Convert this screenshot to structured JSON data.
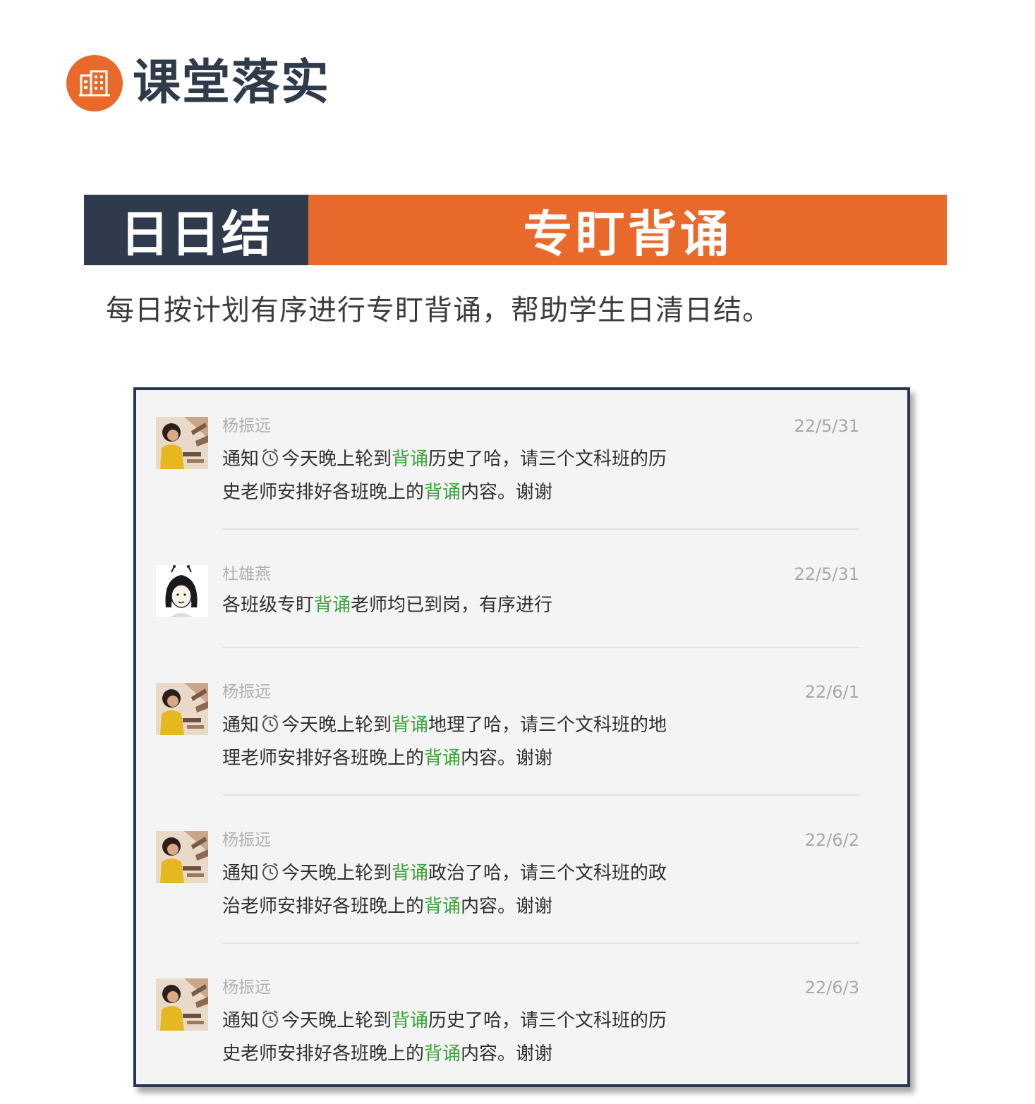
{
  "section": {
    "icon": "building-icon",
    "title": "课堂落实"
  },
  "banner": {
    "left_label": "日日结",
    "right_label": "专盯背诵"
  },
  "description": "每日按计划有序进行专盯背诵，帮助学生日清日结。",
  "colors": {
    "accent_orange": "#e8692a",
    "navy": "#2f3a4c",
    "highlight_green": "#3aa53a"
  },
  "chat": {
    "messages": [
      {
        "sender": "杨振远",
        "date": "22/5/31",
        "avatar": "photo-avatar",
        "line1": {
          "before": "通知",
          "clock": "alarm-clock-icon",
          "after": "今天晚上轮到",
          "hl": "背诵",
          "tail": "历史了哈，请三个文科班的历"
        },
        "line2": {
          "before": "史老师安排好各班晚上的",
          "hl": "背诵",
          "tail": "内容。谢谢"
        }
      },
      {
        "sender": "杜雄燕",
        "date": "22/5/31",
        "avatar": "cartoon-avatar",
        "line1": {
          "before": "各班级专盯",
          "hl": "背诵",
          "tail": "老师均已到岗，有序进行"
        }
      },
      {
        "sender": "杨振远",
        "date": "22/6/1",
        "avatar": "photo-avatar",
        "line1": {
          "before": "通知",
          "clock": "alarm-clock-icon",
          "after": "今天晚上轮到",
          "hl": "背诵",
          "tail": "地理了哈，请三个文科班的地"
        },
        "line2": {
          "before": "理老师安排好各班晚上的",
          "hl": "背诵",
          "tail": "内容。谢谢"
        }
      },
      {
        "sender": "杨振远",
        "date": "22/6/2",
        "avatar": "photo-avatar",
        "line1": {
          "before": "通知",
          "clock": "alarm-clock-icon",
          "after": "今天晚上轮到",
          "hl": "背诵",
          "tail": "政治了哈，请三个文科班的政"
        },
        "line2": {
          "before": "治老师安排好各班晚上的",
          "hl": "背诵",
          "tail": "内容。谢谢"
        }
      },
      {
        "sender": "杨振远",
        "date": "22/6/3",
        "avatar": "photo-avatar",
        "line1": {
          "before": "通知",
          "clock": "alarm-clock-icon",
          "after": "今天晚上轮到",
          "hl": "背诵",
          "tail": "历史了哈，请三个文科班的历"
        },
        "line2": {
          "before": "史老师安排好各班晚上的",
          "hl": "背诵",
          "tail": "内容。谢谢"
        }
      }
    ]
  }
}
